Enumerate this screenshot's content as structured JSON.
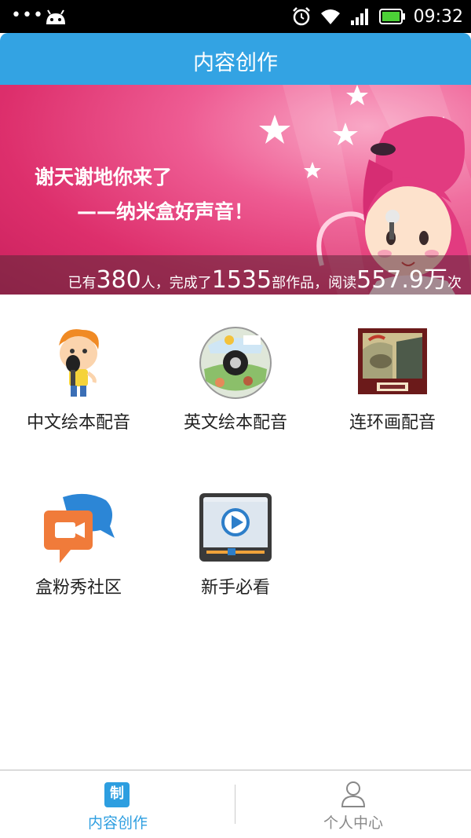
{
  "status_bar": {
    "dots": "•••",
    "time": "09:32"
  },
  "header": {
    "title": "内容创作"
  },
  "banner": {
    "slogan_line1": "谢天谢地你来了",
    "slogan_line2": "——纳米盒好声音！",
    "stats": {
      "prefix": "已有",
      "users": "380",
      "users_unit": "人，完成了",
      "works": "1535",
      "works_unit": "部作品，阅读",
      "reads": "557.9万",
      "reads_unit": "次"
    }
  },
  "menu": {
    "items": [
      {
        "label": "中文绘本配音",
        "icon": "boy-microphone-icon"
      },
      {
        "label": "英文绘本配音",
        "icon": "cd-disc-icon"
      },
      {
        "label": "连环画配音",
        "icon": "comic-frame-icon"
      },
      {
        "label": "盒粉秀社区",
        "icon": "chat-bubble-video-icon"
      },
      {
        "label": "新手必看",
        "icon": "video-play-icon"
      }
    ]
  },
  "bottom_nav": {
    "items": [
      {
        "label": "内容创作",
        "icon_text": "制",
        "active": true
      },
      {
        "label": "个人中心",
        "icon": "user-icon",
        "active": false
      }
    ],
    "active_color": "#2d9ee0",
    "inactive_color": "#888888"
  },
  "colors": {
    "header": "#33a3e3",
    "banner": "#dd2f6c"
  }
}
